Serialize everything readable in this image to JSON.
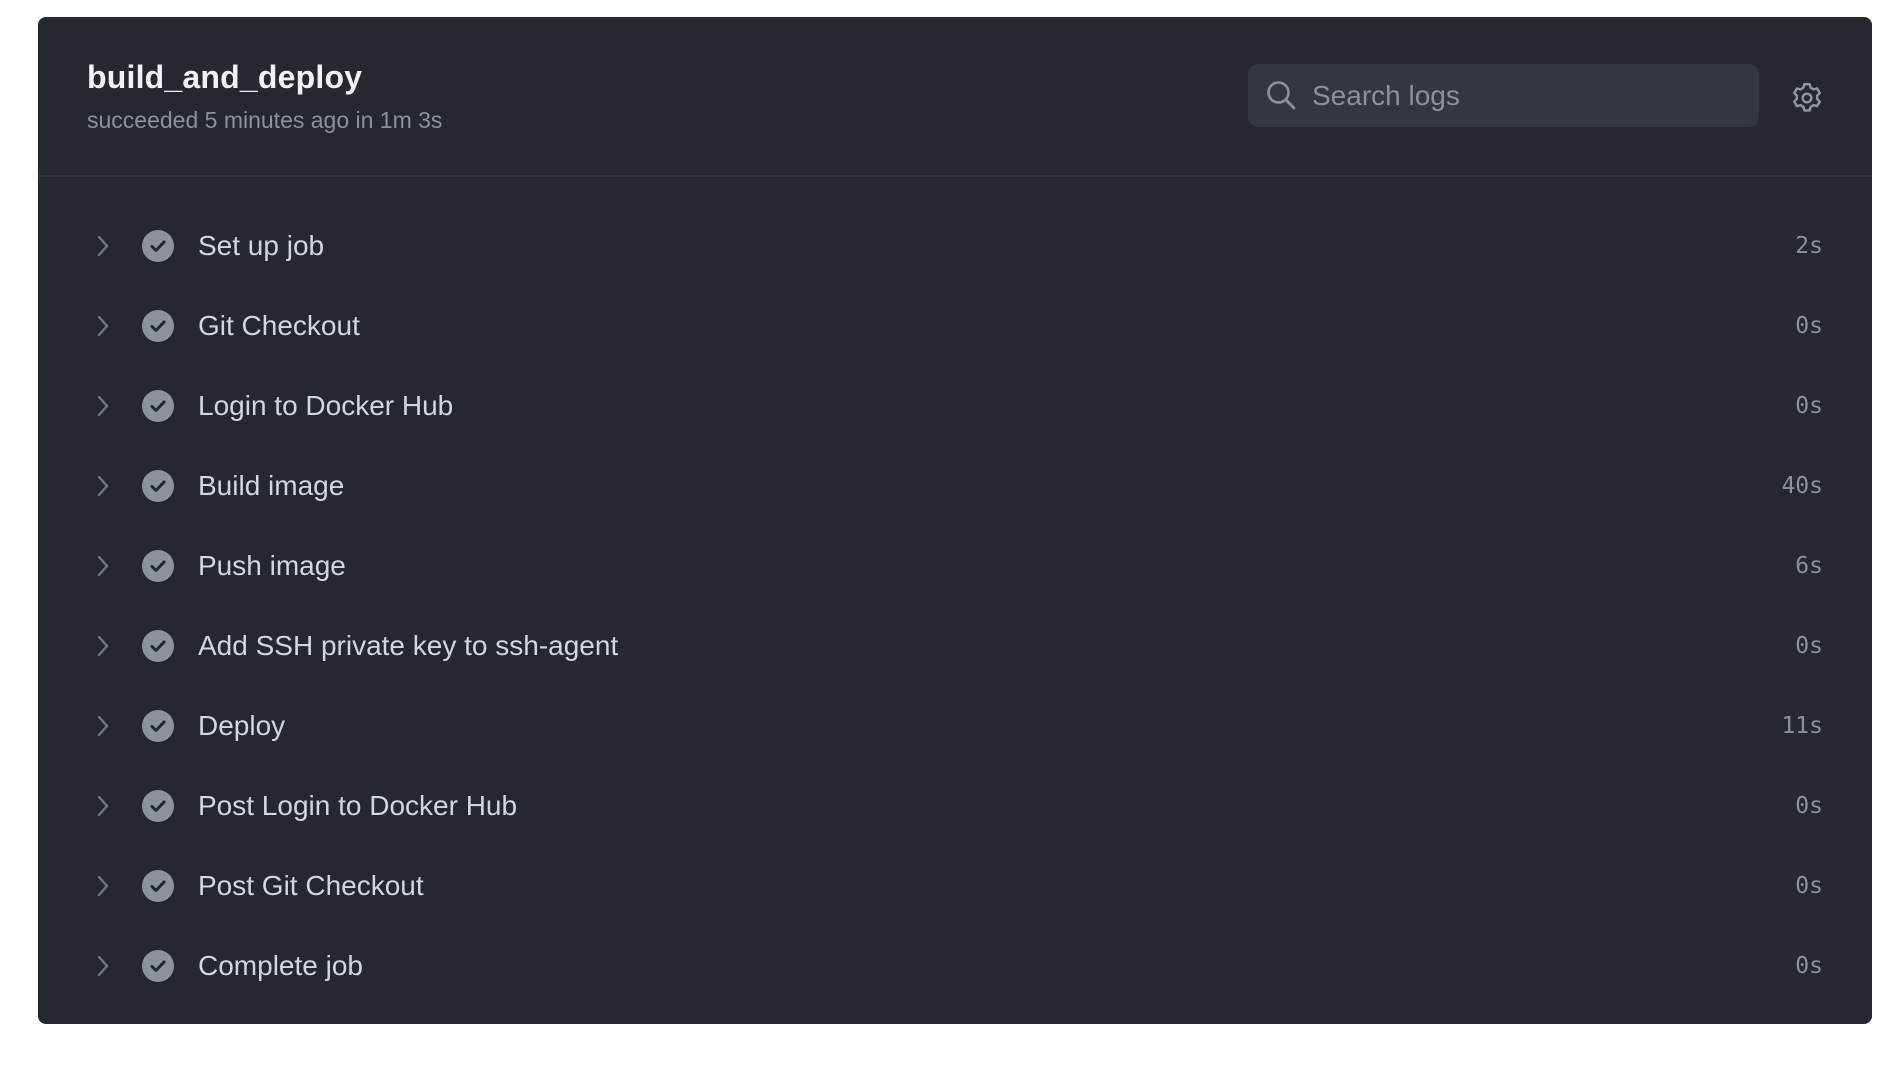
{
  "job": {
    "title": "build_and_deploy",
    "status_line": "succeeded 5 minutes ago in 1m 3s"
  },
  "search": {
    "placeholder": "Search logs",
    "value": "",
    "icon": "search-icon"
  },
  "settings": {
    "icon": "gear-icon"
  },
  "colors": {
    "panel_bg": "#25282e",
    "success_icon": "#8b929b",
    "text": "#d1d7e0",
    "muted": "#8b929b"
  },
  "steps": [
    {
      "label": "Set up job",
      "duration": "2s",
      "status": "success"
    },
    {
      "label": "Git Checkout",
      "duration": "0s",
      "status": "success"
    },
    {
      "label": "Login to Docker Hub",
      "duration": "0s",
      "status": "success"
    },
    {
      "label": "Build image",
      "duration": "40s",
      "status": "success"
    },
    {
      "label": "Push image",
      "duration": "6s",
      "status": "success"
    },
    {
      "label": "Add SSH private key to ssh-agent",
      "duration": "0s",
      "status": "success"
    },
    {
      "label": "Deploy",
      "duration": "11s",
      "status": "success"
    },
    {
      "label": "Post Login to Docker Hub",
      "duration": "0s",
      "status": "success"
    },
    {
      "label": "Post Git Checkout",
      "duration": "0s",
      "status": "success"
    },
    {
      "label": "Complete job",
      "duration": "0s",
      "status": "success"
    }
  ]
}
